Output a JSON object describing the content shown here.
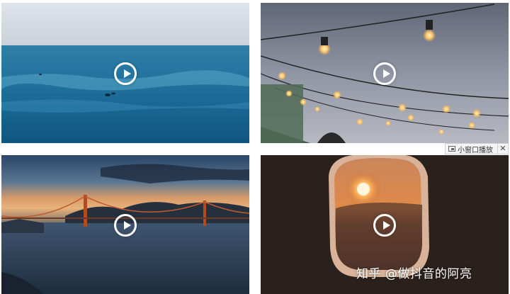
{
  "tiles": [
    {
      "scene": "ocean-waves-surfers",
      "play_icon": "play-circle-icon"
    },
    {
      "scene": "string-lights-dusk",
      "play_icon": "play-circle-icon"
    },
    {
      "scene": "golden-gate-bridge-sunset",
      "play_icon": "play-circle-icon"
    },
    {
      "scene": "airplane-window-sunset",
      "play_icon": "play-circle-icon"
    }
  ],
  "pip_bar": {
    "icon": "picture-in-picture-icon",
    "label": "小窗口播放",
    "close": "✕"
  },
  "watermark": {
    "text": "知乎 @做抖音的阿亮"
  }
}
